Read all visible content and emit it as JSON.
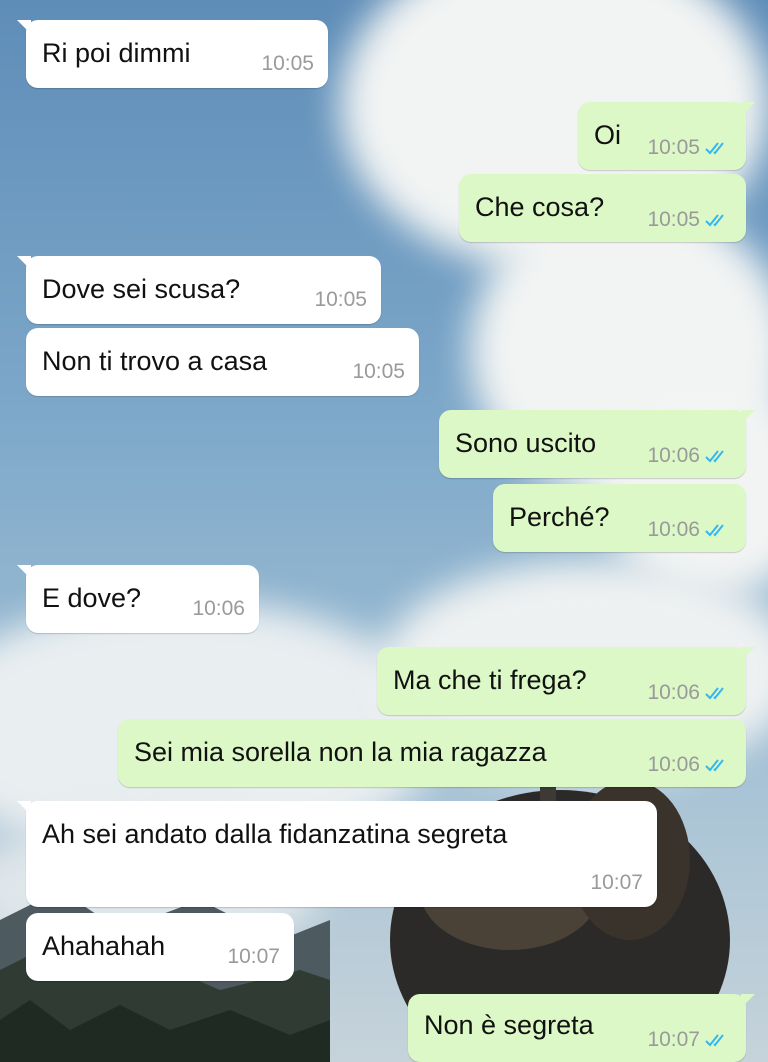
{
  "colors": {
    "incoming_bubble": "#ffffff",
    "outgoing_bubble": "#dcf8c6",
    "read_tick": "#34b7f1",
    "timestamp": "#9a9a9a"
  },
  "messages": [
    {
      "direction": "incoming",
      "text": "Ri poi dimmi",
      "time": "10:05"
    },
    {
      "direction": "outgoing",
      "text": "Oi",
      "time": "10:05",
      "status": "read-ticks-icon"
    },
    {
      "direction": "outgoing",
      "text": "Che cosa?",
      "time": "10:05",
      "status": "read-ticks-icon"
    },
    {
      "direction": "incoming",
      "text": "Dove sei scusa?",
      "time": "10:05"
    },
    {
      "direction": "incoming",
      "text": "Non ti trovo a casa",
      "time": "10:05"
    },
    {
      "direction": "outgoing",
      "text": "Sono uscito",
      "time": "10:06",
      "status": "read-ticks-icon"
    },
    {
      "direction": "outgoing",
      "text": "Perché?",
      "time": "10:06",
      "status": "read-ticks-icon"
    },
    {
      "direction": "incoming",
      "text": "E dove?",
      "time": "10:06"
    },
    {
      "direction": "outgoing",
      "text": "Ma che ti frega?",
      "time": "10:06",
      "status": "read-ticks-icon"
    },
    {
      "direction": "outgoing",
      "text": "Sei mia sorella non la mia ragazza",
      "time": "10:06",
      "status": "read-ticks-icon"
    },
    {
      "direction": "incoming",
      "text": "Ah sei andato dalla fidanzatina segreta",
      "time": "10:07"
    },
    {
      "direction": "incoming",
      "text": "Ahahahah",
      "time": "10:07"
    },
    {
      "direction": "outgoing",
      "text": "Non è segreta",
      "time": "10:07",
      "status": "read-ticks-icon"
    }
  ]
}
